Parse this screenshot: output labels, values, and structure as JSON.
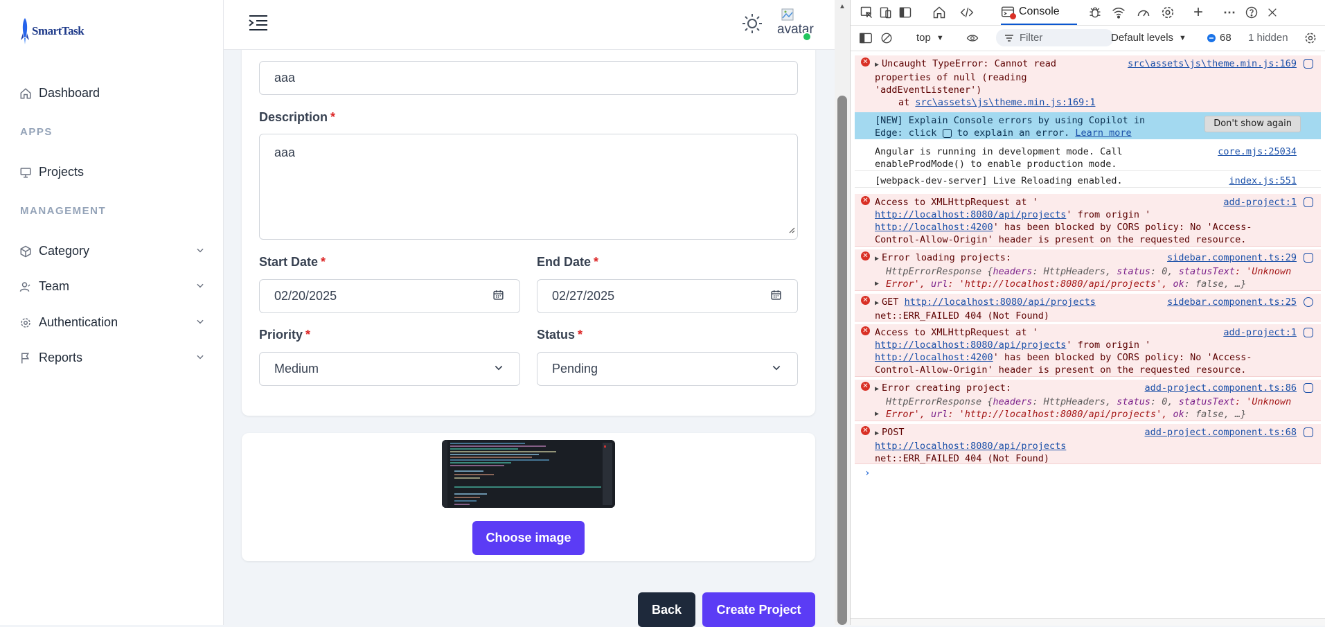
{
  "app": {
    "logo_text": "SmartTask",
    "sidebar": {
      "dashboard": "Dashboard",
      "section_apps": "APPS",
      "projects": "Projects",
      "section_management": "MANAGEMENT",
      "category": "Category",
      "team": "Team",
      "authentication": "Authentication",
      "reports": "Reports"
    },
    "topbar": {
      "avatar_alt": "avatar"
    },
    "form": {
      "name_value": "aaa",
      "description_label": "Description",
      "description_value": "aaa",
      "start_date_label": "Start Date",
      "start_date_value": "02/20/2025",
      "end_date_label": "End Date",
      "end_date_value": "02/27/2025",
      "priority_label": "Priority",
      "priority_value": "Medium",
      "status_label": "Status",
      "status_value": "Pending",
      "required_mark": "*"
    },
    "upload": {
      "choose_image_label": "Choose image"
    },
    "actions": {
      "back_label": "Back",
      "create_label": "Create Project"
    }
  },
  "devtools": {
    "active_tab": "Console",
    "toolbar": {
      "context": "top",
      "filter_placeholder": "Filter",
      "levels": "Default levels",
      "message_count": "68",
      "hidden": "1 hidden"
    },
    "messages": {
      "m1_l1": "Uncaught TypeError: Cannot read",
      "m1_l2": "properties of null (reading",
      "m1_l3": "'addEventListener')",
      "m1_l4_pre": "at",
      "m1_l4_link": "src\\assets\\js\\theme.min.js:169:1",
      "m1_src": "src\\assets\\js\\theme.min.js:169",
      "banner_l1": "[NEW] Explain Console errors by using Copilot in",
      "banner_l2_pre": "Edge: click",
      "banner_l2_post": "to explain an error.",
      "banner_learn": "Learn more",
      "banner_dismiss": "Don't show again",
      "m2_l1": "Angular is running in development mode. Call",
      "m2_l2": "enableProdMode() to enable production mode.",
      "m2_src": "core.mjs:25034",
      "m3_l1": "[webpack-dev-server] Live Reloading enabled.",
      "m3_src": "index.js:551",
      "m4_l1": "Access to XMLHttpRequest at '",
      "m4_l2_link": "http://localhost:8080/api/projects",
      "m4_l2_post": "' from origin '",
      "m4_l3_link": "http://localhost:4200",
      "m4_l3_post": "' has been blocked by CORS policy: No 'Access-",
      "m4_l4": "Control-Allow-Origin' header is present on the requested resource.",
      "m4_src": "add-project:1",
      "m5_l1": "Error loading projects:",
      "m5_src": "sidebar.component.ts:29",
      "m5_l2_a": "HttpErrorResponse {",
      "m5_l2_k1": "headers",
      "m5_l2_v1": ": HttpHeaders, ",
      "m5_l2_k2": "status",
      "m5_l2_v2": ": 0, ",
      "m5_l2_k3": "statusText",
      "m5_l2_v3": ": 'Unknown",
      "m5_l3_a": "Error', ",
      "m5_l3_k1": "url",
      "m5_l3_v1": ": 'http://localhost:8080/api/projects', ",
      "m5_l3_k2": "ok",
      "m5_l3_v2": ": false, …}",
      "m6_l1_pre": "GET",
      "m6_l1_link": "http://localhost:8080/api/projects",
      "m6_l2": "net::ERR_FAILED 404 (Not Found)",
      "m6_src": "sidebar.component.ts:25",
      "m7_l1": "Access to XMLHttpRequest at '",
      "m7_l2_link": "http://localhost:8080/api/projects",
      "m7_l2_post": "' from origin '",
      "m7_l3_link": "http://localhost:4200",
      "m7_l3_post": "' has been blocked by CORS policy: No 'Access-",
      "m7_l4": "Control-Allow-Origin' header is present on the requested resource.",
      "m7_src": "add-project:1",
      "m8_l1": "Error creating project:",
      "m8_src": "add-project.component.ts:86",
      "m9_l1": "POST",
      "m9_l2_link": "http://localhost:8080/api/projects",
      "m9_l3": "net::ERR_FAILED 404 (Not Found)",
      "m9_src": "add-project.component.ts:68"
    }
  },
  "colors": {
    "primary": "#5b3cf5",
    "dark_button": "#1e293b",
    "required": "#dc2626",
    "error_bg": "#fcebeb",
    "banner_bg": "#a3d9f0",
    "link": "#1a4fa8"
  }
}
